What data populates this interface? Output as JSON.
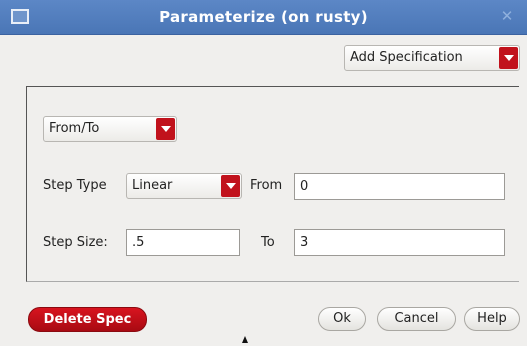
{
  "window": {
    "title": "Parameterize (on rusty)",
    "close_glyph": "✕",
    "accent_color": "#4a76b6"
  },
  "add_spec": {
    "selected": "Add Specification"
  },
  "range": {
    "mode_selected": "From/To",
    "step_type_label": "Step Type",
    "step_type_selected": "Linear",
    "from_label": "From",
    "from_value": "0",
    "step_size_label": "Step Size:",
    "step_size_value": ".5",
    "to_label": "To",
    "to_value": "3"
  },
  "footer": {
    "delete_label": "Delete Spec",
    "ok_label": "Ok",
    "cancel_label": "Cancel",
    "help_label": "Help"
  },
  "colors": {
    "dropdown_arrow": "#c1121c",
    "danger": "#c1121c"
  }
}
